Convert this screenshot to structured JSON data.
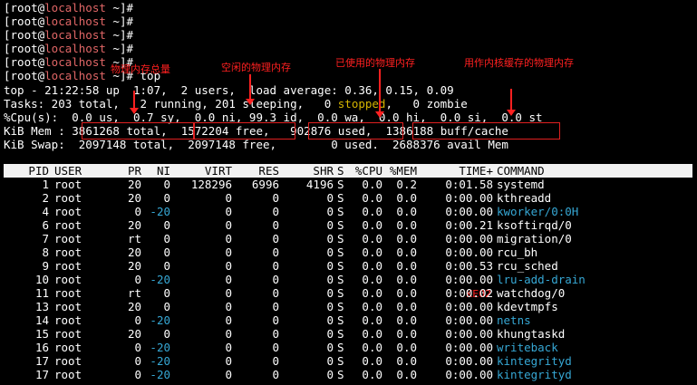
{
  "prompt_lines": [
    {
      "pre": "[root@",
      "host": "localhost",
      "post": " ~]#"
    },
    {
      "pre": "[root@",
      "host": "localhost",
      "post": " ~]#"
    },
    {
      "pre": "[root@",
      "host": "localhost",
      "post": " ~]#"
    },
    {
      "pre": "[root@",
      "host": "localhost",
      "post": " ~]#"
    },
    {
      "pre": "[root@",
      "host": "localhost",
      "post": " ~]#"
    },
    {
      "pre": "[root@",
      "host": "localhost",
      "post": " ~]# top"
    }
  ],
  "summary": {
    "top_line": "top - 21:22:58 up  1:07,  2 users,  load average: 0.36, 0.15, 0.09",
    "tasks_pre": "Tasks: 203 total,   2 running, 201 sleeping,   0 ",
    "tasks_stopped": "stopped",
    "tasks_post": ",   0 zombie",
    "cpu_line": "%Cpu(s):  0.0 us,  0.7 sy,  0.0 ni, 99.3 id,  0.0 wa,  0.0 hi,  0.0 si,  0.0 st",
    "mem_label": "KiB Mem : ",
    "mem_total": "3861268 total,",
    "mem_free": "1572204 free,",
    "mem_used": " 902876 used,",
    "mem_cache": "1386188 buff/cache",
    "swap_line": "KiB Swap:  2097148 total,  2097148 free,        0 used.  2688376 avail Mem"
  },
  "annotations": {
    "total": "物理内存总量",
    "free": "空闲的物理内存",
    "used": "已使用的物理内存",
    "cache": "用作内核缓存的物理内存",
    "stray": "KE02"
  },
  "columns": [
    "PID",
    "USER",
    "PR",
    "NI",
    "VIRT",
    "RES",
    "SHR",
    "S",
    "%CPU",
    "%MEM",
    "TIME+",
    "COMMAND"
  ],
  "processes": [
    {
      "pid": "1",
      "user": "root",
      "pr": "20",
      "ni": "0",
      "virt": "128296",
      "res": "6996",
      "shr": "4196",
      "s": "S",
      "cpu": "0.0",
      "mem": "0.2",
      "time": "0:01.58",
      "cmd": "systemd"
    },
    {
      "pid": "2",
      "user": "root",
      "pr": "20",
      "ni": "0",
      "virt": "0",
      "res": "0",
      "shr": "0",
      "s": "S",
      "cpu": "0.0",
      "mem": "0.0",
      "time": "0:00.00",
      "cmd": "kthreadd"
    },
    {
      "pid": "4",
      "user": "root",
      "pr": "0",
      "ni": "-20",
      "virt": "0",
      "res": "0",
      "shr": "0",
      "s": "S",
      "cpu": "0.0",
      "mem": "0.0",
      "time": "0:00.00",
      "cmd": "kworker/0:0H"
    },
    {
      "pid": "6",
      "user": "root",
      "pr": "20",
      "ni": "0",
      "virt": "0",
      "res": "0",
      "shr": "0",
      "s": "S",
      "cpu": "0.0",
      "mem": "0.0",
      "time": "0:00.21",
      "cmd": "ksoftirqd/0"
    },
    {
      "pid": "7",
      "user": "root",
      "pr": "rt",
      "ni": "0",
      "virt": "0",
      "res": "0",
      "shr": "0",
      "s": "S",
      "cpu": "0.0",
      "mem": "0.0",
      "time": "0:00.00",
      "cmd": "migration/0"
    },
    {
      "pid": "8",
      "user": "root",
      "pr": "20",
      "ni": "0",
      "virt": "0",
      "res": "0",
      "shr": "0",
      "s": "S",
      "cpu": "0.0",
      "mem": "0.0",
      "time": "0:00.00",
      "cmd": "rcu_bh"
    },
    {
      "pid": "9",
      "user": "root",
      "pr": "20",
      "ni": "0",
      "virt": "0",
      "res": "0",
      "shr": "0",
      "s": "S",
      "cpu": "0.0",
      "mem": "0.0",
      "time": "0:00.53",
      "cmd": "rcu_sched"
    },
    {
      "pid": "10",
      "user": "root",
      "pr": "0",
      "ni": "-20",
      "virt": "0",
      "res": "0",
      "shr": "0",
      "s": "S",
      "cpu": "0.0",
      "mem": "0.0",
      "time": "0:00.00",
      "cmd": "lru-add-drain"
    },
    {
      "pid": "11",
      "user": "root",
      "pr": "rt",
      "ni": "0",
      "virt": "0",
      "res": "0",
      "shr": "0",
      "s": "S",
      "cpu": "0.0",
      "mem": "0.0",
      "time": "0:00.02",
      "cmd": "watchdog/0"
    },
    {
      "pid": "13",
      "user": "root",
      "pr": "20",
      "ni": "0",
      "virt": "0",
      "res": "0",
      "shr": "0",
      "s": "S",
      "cpu": "0.0",
      "mem": "0.0",
      "time": "0:00.00",
      "cmd": "kdevtmpfs"
    },
    {
      "pid": "14",
      "user": "root",
      "pr": "0",
      "ni": "-20",
      "virt": "0",
      "res": "0",
      "shr": "0",
      "s": "S",
      "cpu": "0.0",
      "mem": "0.0",
      "time": "0:00.00",
      "cmd": "netns"
    },
    {
      "pid": "15",
      "user": "root",
      "pr": "20",
      "ni": "0",
      "virt": "0",
      "res": "0",
      "shr": "0",
      "s": "S",
      "cpu": "0.0",
      "mem": "0.0",
      "time": "0:00.00",
      "cmd": "khungtaskd"
    },
    {
      "pid": "16",
      "user": "root",
      "pr": "0",
      "ni": "-20",
      "virt": "0",
      "res": "0",
      "shr": "0",
      "s": "S",
      "cpu": "0.0",
      "mem": "0.0",
      "time": "0:00.00",
      "cmd": "writeback"
    },
    {
      "pid": "17",
      "user": "root",
      "pr": "0",
      "ni": "-20",
      "virt": "0",
      "res": "0",
      "shr": "0",
      "s": "S",
      "cpu": "0.0",
      "mem": "0.0",
      "time": "0:00.00",
      "cmd": "kintegrityd"
    },
    {
      "pid": "17",
      "user": "root",
      "pr": "0",
      "ni": "-20",
      "virt": "0",
      "res": "0",
      "shr": "0",
      "s": "S",
      "cpu": "0.0",
      "mem": "0.0",
      "time": "0:00.00",
      "cmd": "kintegrityd"
    }
  ],
  "colors": {
    "hostname": "#e06666",
    "stopped": "#d4b400",
    "nice_negative": "#36a7d4",
    "annotation": "#ff2020",
    "header_bg": "#f2f2f2"
  }
}
